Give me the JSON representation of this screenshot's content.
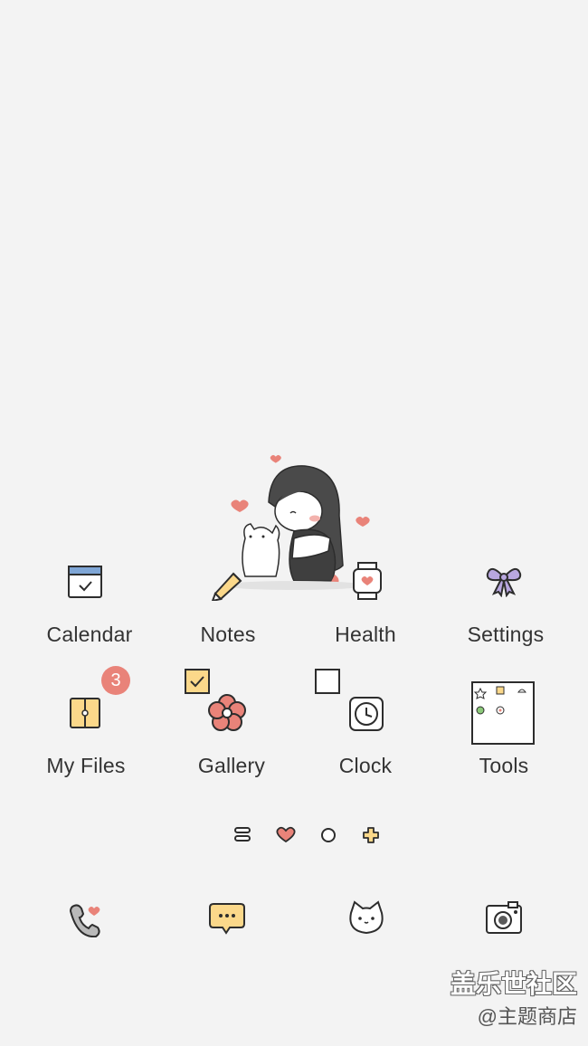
{
  "apps_row1": [
    {
      "label": "Calendar",
      "icon": "calendar-icon"
    },
    {
      "label": "Notes",
      "icon": "pencil-icon"
    },
    {
      "label": "Health",
      "icon": "watch-heart-icon"
    },
    {
      "label": "Settings",
      "icon": "ribbon-bow-icon"
    }
  ],
  "apps_row2": [
    {
      "label": "My Files",
      "icon": "folder-file-icon",
      "badge": "3"
    },
    {
      "label": "Gallery",
      "icon": "flower-icon"
    },
    {
      "label": "Clock",
      "icon": "clock-icon"
    },
    {
      "label": "Tools",
      "icon": "tools-folder-icon"
    }
  ],
  "page_indicators": [
    "menu-lines-icon",
    "heart-icon",
    "circle-icon",
    "plus-icon"
  ],
  "dock": [
    "phone-heart-icon",
    "chat-bubble-icon",
    "cat-face-icon",
    "camera-icon"
  ],
  "watermark": {
    "line1": "盖乐世社区",
    "line2": "@主题商店"
  },
  "colors": {
    "background": "#f3f3f3",
    "badge": "#e98379",
    "accent_yellow": "#fbd88a",
    "accent_pink": "#e98379",
    "accent_purple": "#b8a7df"
  }
}
